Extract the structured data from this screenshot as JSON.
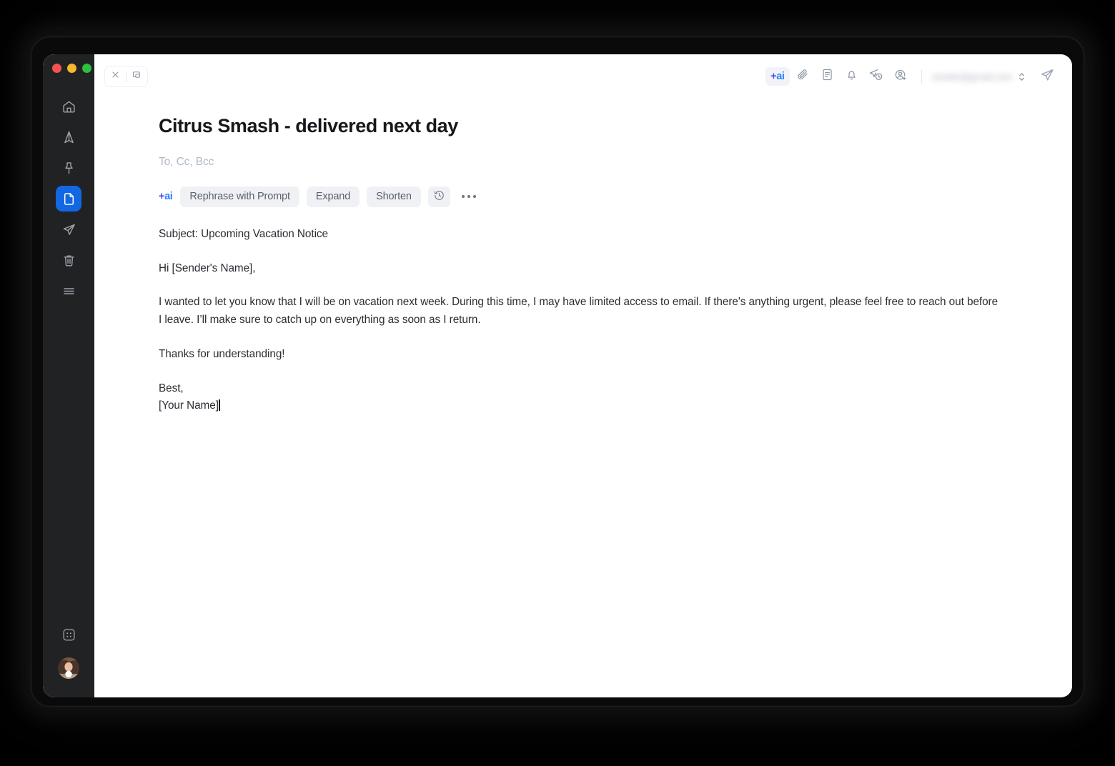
{
  "window": {
    "traffic_lights": [
      {
        "name": "close",
        "color": "#F0544C"
      },
      {
        "name": "minimize",
        "color": "#F5B82E"
      },
      {
        "name": "zoom",
        "color": "#2BC03F"
      }
    ]
  },
  "sidebar": {
    "items": [
      {
        "icon": "home-icon",
        "label": "Home",
        "active": false
      },
      {
        "icon": "send-up-icon",
        "label": "Sent",
        "active": false
      },
      {
        "icon": "pin-icon",
        "label": "Pinned",
        "active": false
      },
      {
        "icon": "document-icon",
        "label": "Drafts",
        "active": true
      },
      {
        "icon": "paper-plane-icon",
        "label": "Outbox",
        "active": false
      },
      {
        "icon": "trash-icon",
        "label": "Trash",
        "active": false
      },
      {
        "icon": "menu-icon",
        "label": "More",
        "active": false
      }
    ],
    "bottom": [
      {
        "icon": "apps-grid-icon",
        "label": "Apps"
      },
      {
        "icon": "avatar",
        "label": "Account"
      }
    ]
  },
  "compose_bar": {
    "window_controls": [
      {
        "icon": "close-icon",
        "label": "Close compose"
      },
      {
        "icon": "minimize-icon",
        "label": "Minimize compose"
      }
    ],
    "ai_badge": {
      "plus": "+",
      "ai": "ai"
    },
    "tools": [
      {
        "icon": "paperclip-icon",
        "label": "Attach file"
      },
      {
        "icon": "template-icon",
        "label": "Templates"
      },
      {
        "icon": "bell-icon",
        "label": "Remind me"
      },
      {
        "icon": "send-later-icon",
        "label": "Send later"
      },
      {
        "icon": "add-contact-icon",
        "label": "Add recipient"
      }
    ],
    "sender_email": "sender@gmail.com",
    "send_icon": "send-icon"
  },
  "compose": {
    "subject": "Citrus Smash - delivered next day",
    "recipients_placeholder": "To, Cc, Bcc"
  },
  "ai_actions": {
    "badge_plus": "+",
    "badge_ai": "ai",
    "chips": [
      {
        "label": "Rephrase with Prompt"
      },
      {
        "label": "Expand"
      },
      {
        "label": "Shorten"
      }
    ],
    "history_icon": "history-icon",
    "more_icon": "ellipsis-icon"
  },
  "message": {
    "paragraphs": [
      "Subject: Upcoming Vacation Notice",
      "Hi [Sender's Name],",
      "I wanted to let you know that I will be on vacation next week. During this time, I may have limited access to email. If there's anything urgent, please feel free to reach out before I leave. I’ll make sure to catch up on everything as soon as I return.",
      "Thanks for understanding!"
    ],
    "signoff": "Best,",
    "signature": "[Your Name]"
  },
  "colors": {
    "accent_blue": "#1268E3",
    "ai_plus": "#4B49F0",
    "ai_text": "#2B7FFF",
    "sidebar_bg": "#212224",
    "chip_bg": "#EFF1F5"
  }
}
